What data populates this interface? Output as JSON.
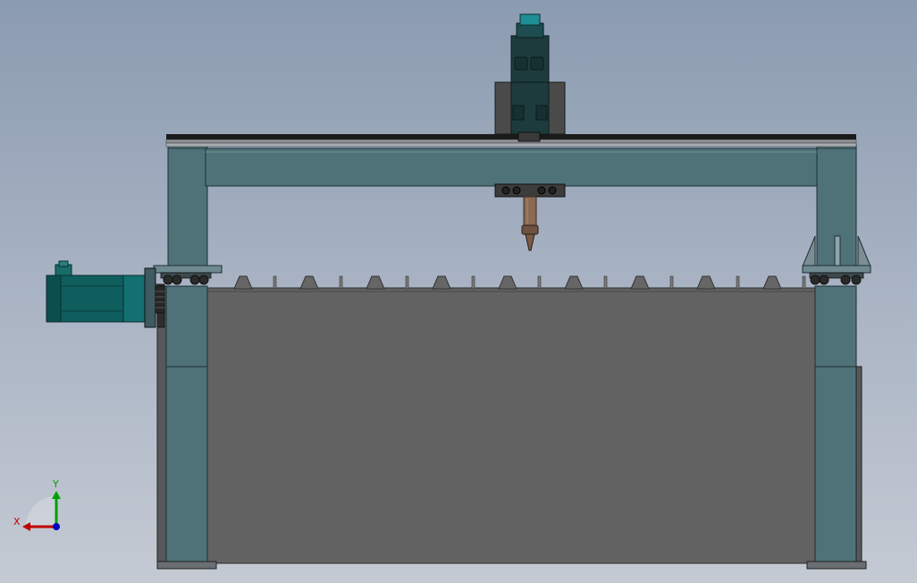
{
  "view": {
    "background_top": "#8b9bb0",
    "background_bottom": "#c4cad3"
  },
  "colors": {
    "frame_teal": "#4e7278",
    "frame_edge": "#1f2f33",
    "bed_gray": "#626262",
    "motor_teal": "#0f5d5d",
    "rail_dark": "#1b1b1b",
    "carriage_gray": "#4a4a4a",
    "torch_copper": "#8a6a52"
  },
  "triad": {
    "x_label": "X",
    "y_label": "Y",
    "x_color": "#c00000",
    "y_color": "#00a000",
    "z_color": "#0000c0"
  },
  "parts": {
    "gantry_beam": "beam",
    "left_leg": "leg",
    "right_leg": "leg",
    "bed": "bed",
    "servo_motor": "motor",
    "cutting_head": "torch",
    "z_carriage": "carriage",
    "slats": 9
  }
}
